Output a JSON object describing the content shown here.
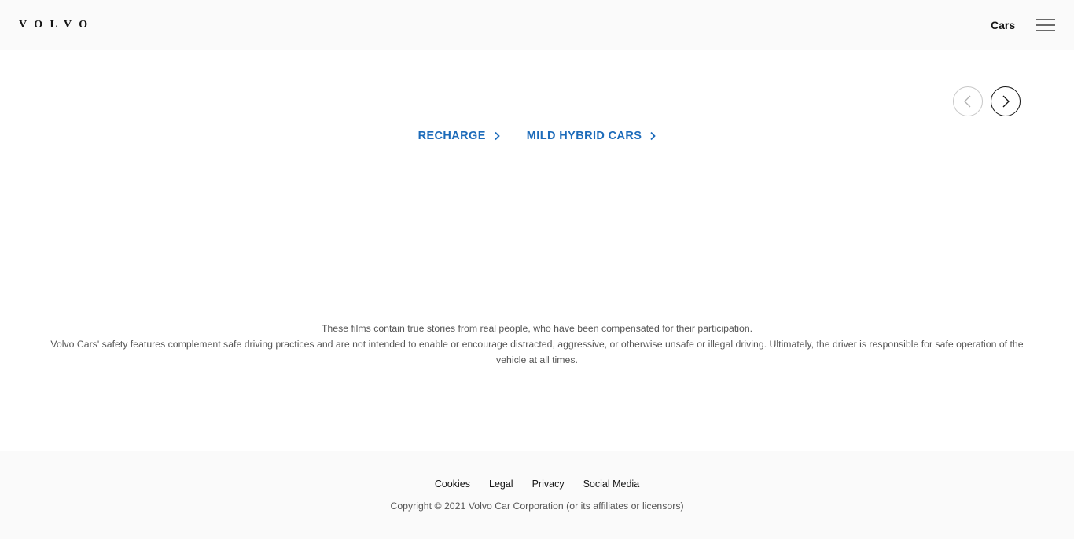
{
  "header": {
    "logo_text": "VOLVO",
    "nav_cars_label": "Cars",
    "menu_icon": "hamburger-menu-icon"
  },
  "carousel": {
    "prev_icon": "chevron-left-icon",
    "next_icon": "chevron-right-icon"
  },
  "links": [
    {
      "label": "RECHARGE",
      "icon": "chevron-right-icon"
    },
    {
      "label": "MILD HYBRID CARS",
      "icon": "chevron-right-icon"
    }
  ],
  "disclaimer": {
    "line1": "These films contain true stories from real people, who have been compensated for their participation.",
    "line2": "Volvo Cars' safety features complement safe driving practices and are not intended to enable or encourage distracted, aggressive, or otherwise unsafe or illegal driving. Ultimately, the driver is responsible for safe operation of the vehicle at all times."
  },
  "footer": {
    "links": [
      "Cookies",
      "Legal",
      "Privacy",
      "Social Media"
    ],
    "copyright": "Copyright © 2021 Volvo Car Corporation (or its affiliates or licensors)"
  },
  "colors": {
    "accent": "#1c6bba",
    "header_bg": "#fafafa",
    "text": "#141414",
    "muted_text": "#555555"
  }
}
